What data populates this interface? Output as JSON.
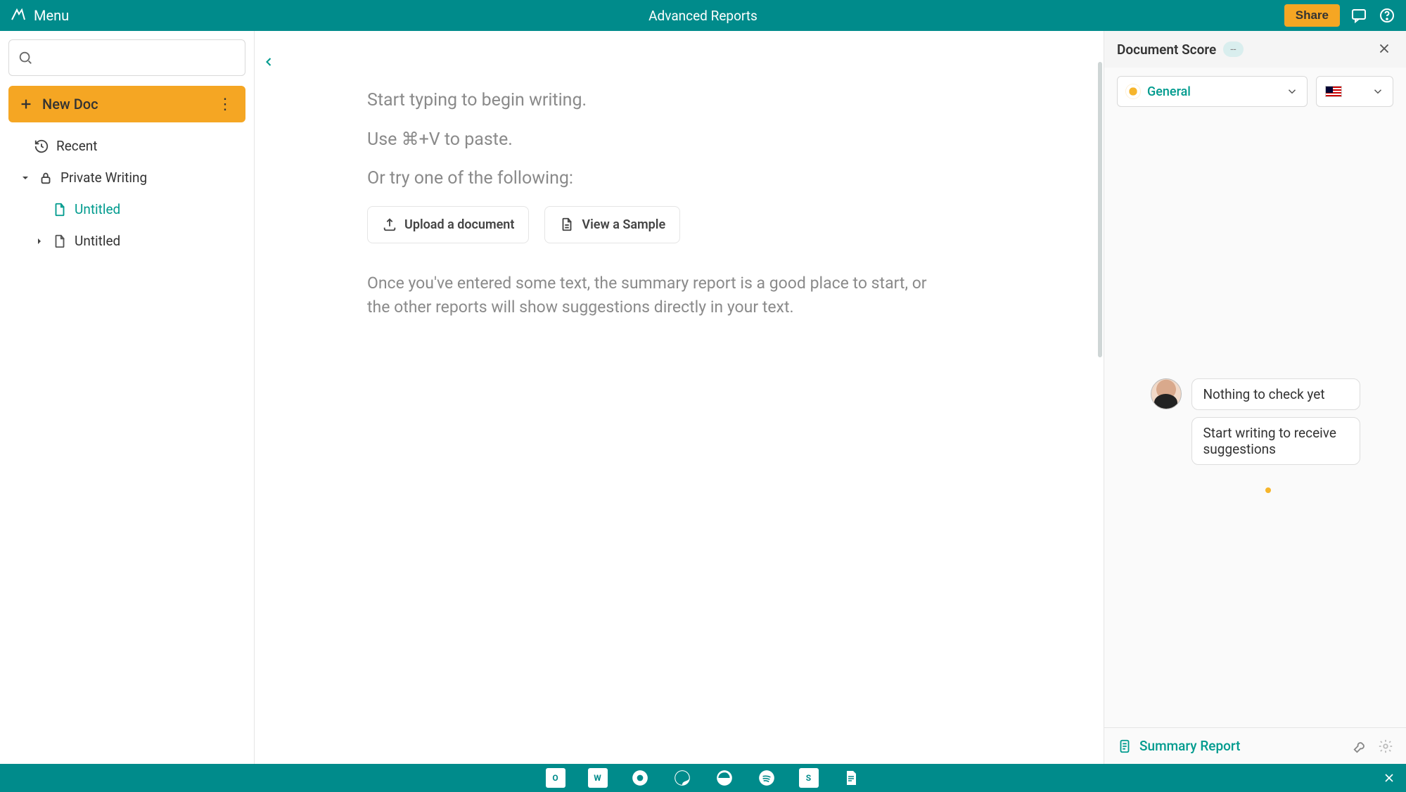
{
  "topbar": {
    "menu_label": "Menu",
    "title": "Advanced Reports",
    "share_label": "Share"
  },
  "sidebar": {
    "search_placeholder": "",
    "newdoc_label": "New Doc",
    "items": [
      {
        "icon": "recent",
        "label": "Recent"
      },
      {
        "icon": "lock",
        "label": "Private Writing",
        "expanded": true
      },
      {
        "icon": "doc",
        "label": "Untitled",
        "active": true,
        "indent": 1
      },
      {
        "icon": "doc",
        "label": "Untitled",
        "indent": 2,
        "collapsed": true
      }
    ]
  },
  "editor": {
    "line1": "Start typing to begin writing.",
    "line2": "Use ⌘+V to paste.",
    "line3": "Or try one of the following:",
    "upload_label": "Upload a document",
    "sample_label": "View a Sample",
    "hint": "Once you've entered some text, the summary report is a good place to start, or the other reports will show suggestions directly in your text."
  },
  "rightpanel": {
    "title": "Document Score",
    "score": "--",
    "style_label": "General",
    "bubble1": "Nothing to check yet",
    "bubble2": "Start writing to receive suggestions",
    "summary_label": "Summary Report"
  },
  "dock": {
    "apps": [
      "outlook",
      "word",
      "chrome",
      "firefox",
      "edge",
      "spotify",
      "s-app",
      "doc-app"
    ]
  }
}
